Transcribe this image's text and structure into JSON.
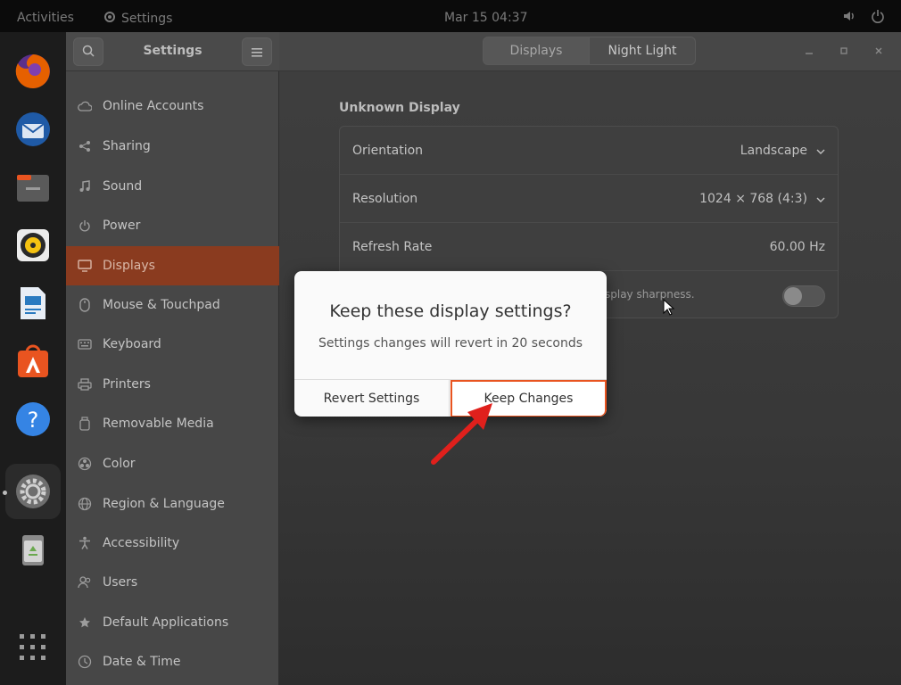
{
  "topbar": {
    "activities": "Activities",
    "app_name": "Settings",
    "clock": "Mar 15  04:37"
  },
  "dock": {
    "items": [
      {
        "name": "Firefox",
        "color": "#e66000"
      },
      {
        "name": "Thunderbird",
        "color": "#2c76c5"
      },
      {
        "name": "Files",
        "color": "#4c4c4c"
      },
      {
        "name": "Rhythmbox",
        "color": "#f5c211"
      },
      {
        "name": "LibreOffice Writer",
        "color": "#2a7ac0"
      },
      {
        "name": "Ubuntu Software",
        "color": "#e95420"
      },
      {
        "name": "Help",
        "color": "#3584e4"
      },
      {
        "name": "Settings",
        "color": "#888888"
      },
      {
        "name": "Trash",
        "color": "#6aa84f"
      }
    ]
  },
  "sidebar": {
    "title": "Settings",
    "items": [
      {
        "label": "Online Accounts",
        "icon": "cloud-icon"
      },
      {
        "label": "Sharing",
        "icon": "share-icon"
      },
      {
        "label": "Sound",
        "icon": "music-note-icon"
      },
      {
        "label": "Power",
        "icon": "power-icon"
      },
      {
        "label": "Displays",
        "icon": "display-icon",
        "active": true
      },
      {
        "label": "Mouse & Touchpad",
        "icon": "mouse-icon"
      },
      {
        "label": "Keyboard",
        "icon": "keyboard-icon"
      },
      {
        "label": "Printers",
        "icon": "printer-icon"
      },
      {
        "label": "Removable Media",
        "icon": "usb-icon"
      },
      {
        "label": "Color",
        "icon": "color-icon"
      },
      {
        "label": "Region & Language",
        "icon": "globe-icon"
      },
      {
        "label": "Accessibility",
        "icon": "accessibility-icon"
      },
      {
        "label": "Users",
        "icon": "users-icon"
      },
      {
        "label": "Default Applications",
        "icon": "star-icon"
      },
      {
        "label": "Date & Time",
        "icon": "clock-icon"
      }
    ]
  },
  "tabs": {
    "displays": "Displays",
    "night_light": "Night Light"
  },
  "display": {
    "section_title": "Unknown Display",
    "orientation": {
      "label": "Orientation",
      "value": "Landscape"
    },
    "resolution": {
      "label": "Resolution",
      "value": "1024 × 768 (4:3)"
    },
    "refresh_rate": {
      "label": "Refresh Rate",
      "value": "60.00 Hz"
    },
    "partial_text": "splay sharpness."
  },
  "dialog": {
    "title": "Keep these display settings?",
    "message": "Settings changes will revert in 20 seconds",
    "revert_label": "Revert Settings",
    "keep_label": "Keep Changes"
  },
  "colors": {
    "accent": "#e95420",
    "annotation_arrow": "#e0201c"
  }
}
